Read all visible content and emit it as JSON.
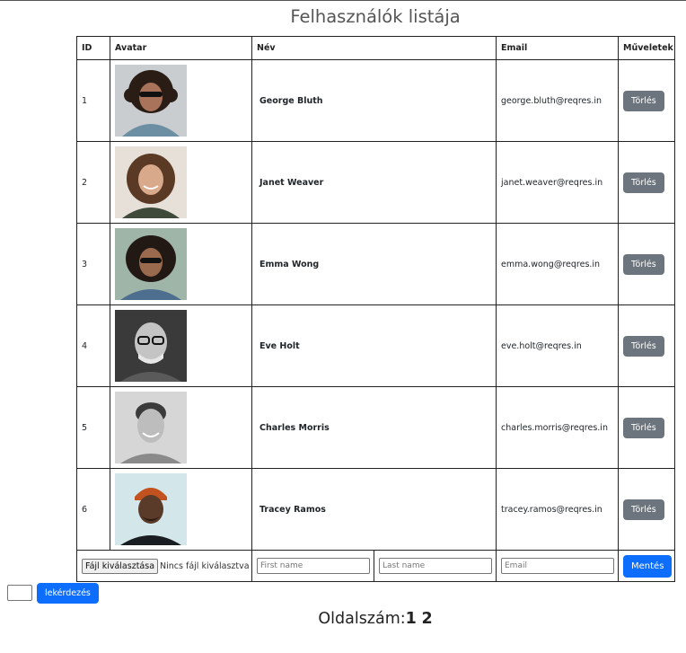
{
  "page": {
    "title": "Felhasználók listája"
  },
  "table": {
    "headers": {
      "id": "ID",
      "avatar": "Avatar",
      "name": "Név",
      "email": "Email",
      "actions": "Műveletek"
    },
    "rows": [
      {
        "id": "1",
        "name": "George Bluth",
        "email": "george.bluth@reqres.in",
        "delete_label": "Törlés"
      },
      {
        "id": "2",
        "name": "Janet Weaver",
        "email": "janet.weaver@reqres.in",
        "delete_label": "Törlés"
      },
      {
        "id": "3",
        "name": "Emma Wong",
        "email": "emma.wong@reqres.in",
        "delete_label": "Törlés"
      },
      {
        "id": "4",
        "name": "Eve Holt",
        "email": "eve.holt@reqres.in",
        "delete_label": "Törlés"
      },
      {
        "id": "5",
        "name": "Charles Morris",
        "email": "charles.morris@reqres.in",
        "delete_label": "Törlés"
      },
      {
        "id": "6",
        "name": "Tracey Ramos",
        "email": "tracey.ramos@reqres.in",
        "delete_label": "Törlés"
      }
    ]
  },
  "form": {
    "file_button": "Fájl kiválasztása",
    "file_status": "Nincs fájl kiválasztva",
    "first_name_placeholder": "First name",
    "last_name_placeholder": "Last name",
    "email_placeholder": "Email",
    "save_label": "Mentés"
  },
  "query": {
    "button_label": "lekérdezés",
    "input_value": ""
  },
  "pagination": {
    "label": "Oldalszám:",
    "pages": [
      "1",
      "2"
    ]
  }
}
